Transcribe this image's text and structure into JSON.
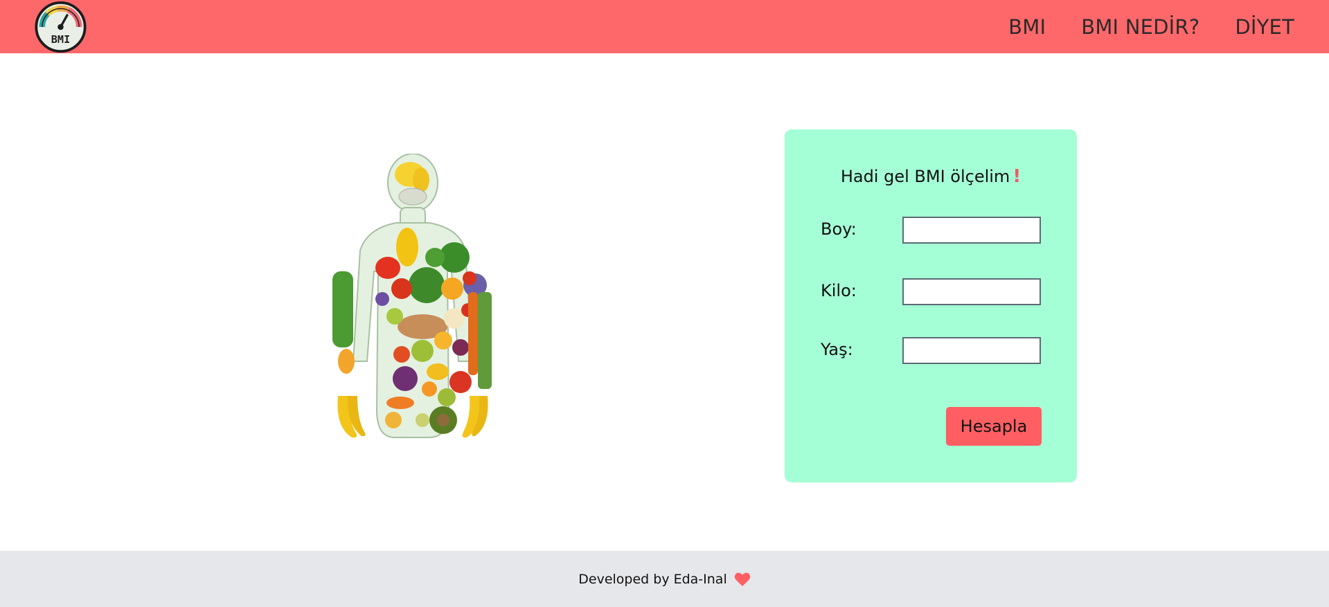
{
  "header": {
    "logo_text": "BMI",
    "nav": [
      {
        "label": "BMI"
      },
      {
        "label": "BMI NEDİR?"
      },
      {
        "label": "DİYET"
      }
    ]
  },
  "form": {
    "title": "Hadi gel BMI ölçelim",
    "title_mark": "!",
    "fields": [
      {
        "label": "Boy:",
        "value": "",
        "placeholder": ""
      },
      {
        "label": "Kilo:",
        "value": "",
        "placeholder": ""
      },
      {
        "label": "Yaş:",
        "value": "",
        "placeholder": ""
      }
    ],
    "submit_label": "Hesapla"
  },
  "footer": {
    "text": "Developed by Eda-Inal",
    "icon": "heart-icon"
  },
  "colors": {
    "header_bg": "#ff686b",
    "card_bg": "#a5ffd6",
    "button_bg": "#ff5e63",
    "footer_bg": "#e6e7eb",
    "accent": "#f05a66"
  }
}
